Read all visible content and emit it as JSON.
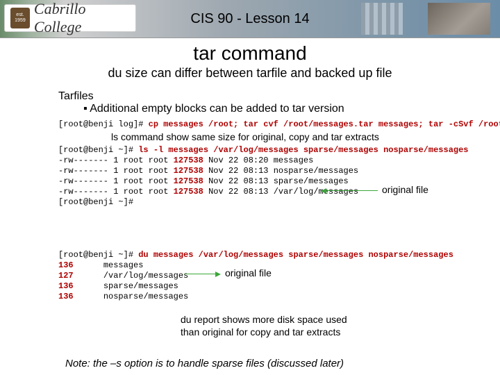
{
  "banner": {
    "course_title": "CIS 90 - Lesson 14",
    "logo_text": "Cabrillo College",
    "logo_badge_top": "est.",
    "logo_badge_bottom": "1959"
  },
  "title": "tar command",
  "subtitle": "du size can differ between tarfile and backed up file",
  "section_heading": "Tarfiles",
  "bullet1": "▪  Additional empty blocks can be added to tar version",
  "cmd1": {
    "prompt": "[root@benji log]# ",
    "cmd": "cp messages /root; tar cvf /root/messages.tar messages; tar -cSvf /root/messagesS.tar messages"
  },
  "caption1": "ls command show same size for original, copy and tar extracts",
  "ls": {
    "prompt": "[root@benji ~]# ",
    "cmd": "ls -l messages /var/log/messages sparse/messages nosparse/messages",
    "rows": [
      {
        "perm": "-rw-------",
        "n": "1",
        "owner": "root",
        "group": "root",
        "size": "127538",
        "date": "Nov 22 08:20",
        "name": "messages"
      },
      {
        "perm": "-rw-------",
        "n": "1",
        "owner": "root",
        "group": "root",
        "size": "127538",
        "date": "Nov 22 08:13",
        "name": "nosparse/messages"
      },
      {
        "perm": "-rw-------",
        "n": "1",
        "owner": "root",
        "group": "root",
        "size": "127538",
        "date": "Nov 22 08:13",
        "name": "sparse/messages"
      },
      {
        "perm": "-rw-------",
        "n": "1",
        "owner": "root",
        "group": "root",
        "size": "127538",
        "date": "Nov 22 08:13",
        "name": "/var/log/messages"
      }
    ],
    "tail_prompt": "[root@benji ~]#"
  },
  "du": {
    "prompt": "[root@benji ~]# ",
    "cmd": "du messages /var/log/messages sparse/messages nosparse/messages",
    "rows": [
      {
        "size": "136",
        "name": "messages"
      },
      {
        "size": "127",
        "name": "/var/log/messages"
      },
      {
        "size": "136",
        "name": "sparse/messages"
      },
      {
        "size": "136",
        "name": "nosparse/messages"
      }
    ]
  },
  "annot_original": "original file",
  "annot_du_original": "original file",
  "du_note_line1": "du report shows more disk space used",
  "du_note_line2": "than original for copy and tar extracts",
  "footnote": "Note: the –s option is to handle sparse files (discussed later)"
}
